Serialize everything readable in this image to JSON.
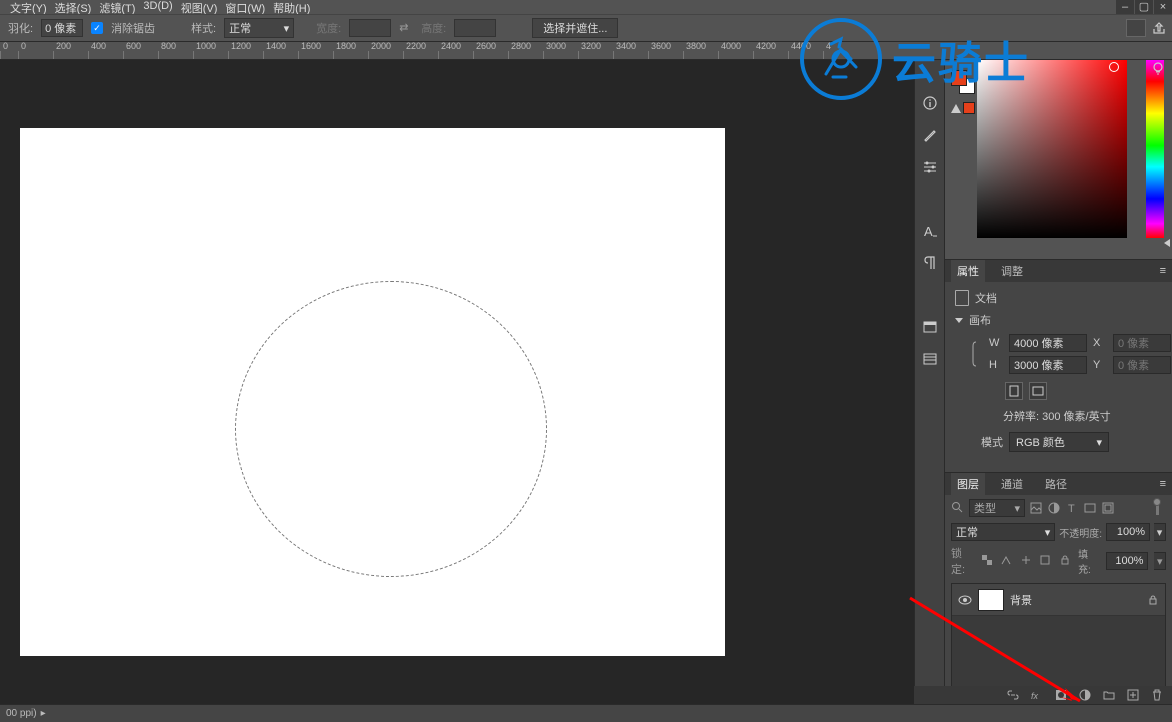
{
  "menu": {
    "items": [
      "文字(Y)",
      "选择(S)",
      "滤镜(T)",
      "3D(D)",
      "视图(V)",
      "窗口(W)",
      "帮助(H)"
    ]
  },
  "optionsbar": {
    "feather_label": "羽化:",
    "feather_value": "0 像素",
    "antialias_label": "消除锯齿",
    "style_label": "样式:",
    "style_value": "正常",
    "width_label": "宽度:",
    "width_value": "",
    "height_label": "高度:",
    "height_value": "",
    "select_mask_btn": "选择并遮住..."
  },
  "ruler": {
    "ticks": [
      "0",
      "0",
      "200",
      "400",
      "600",
      "800",
      "1000",
      "1200",
      "1400",
      "1600",
      "1800",
      "2000",
      "2200",
      "2400",
      "2600",
      "2800",
      "3000",
      "3200",
      "3400",
      "3600",
      "3800",
      "4000",
      "4200",
      "4400",
      "4"
    ]
  },
  "dock": {
    "icons": [
      "info-icon",
      "brush-icon",
      "sliders-icon",
      "type-icon",
      "paragraph-icon",
      "swatches-icon",
      "layers-icon"
    ]
  },
  "properties": {
    "tab_props": "属性",
    "tab_adjust": "调整",
    "doc_label": "文档",
    "canvas_label": "画布",
    "w_label": "W",
    "w_value": "4000 像素",
    "x_label": "X",
    "x_value": "0 像素",
    "h_label": "H",
    "h_value": "3000 像素",
    "y_label": "Y",
    "y_value": "0 像素",
    "resolution_text": "分辨率: 300 像素/英寸",
    "mode_label": "模式",
    "mode_value": "RGB 颜色"
  },
  "layers": {
    "tab_layers": "图层",
    "tab_channels": "通道",
    "tab_paths": "路径",
    "filter_label": "类型",
    "blend_mode": "正常",
    "opacity_label": "不透明度:",
    "opacity_value": "100%",
    "lock_label": "锁定:",
    "fill_label": "填充:",
    "fill_value": "100%",
    "layer0_name": "背景"
  },
  "statusbar": {
    "text": "00 ppi)"
  },
  "watermark": {
    "text": "云骑士"
  }
}
